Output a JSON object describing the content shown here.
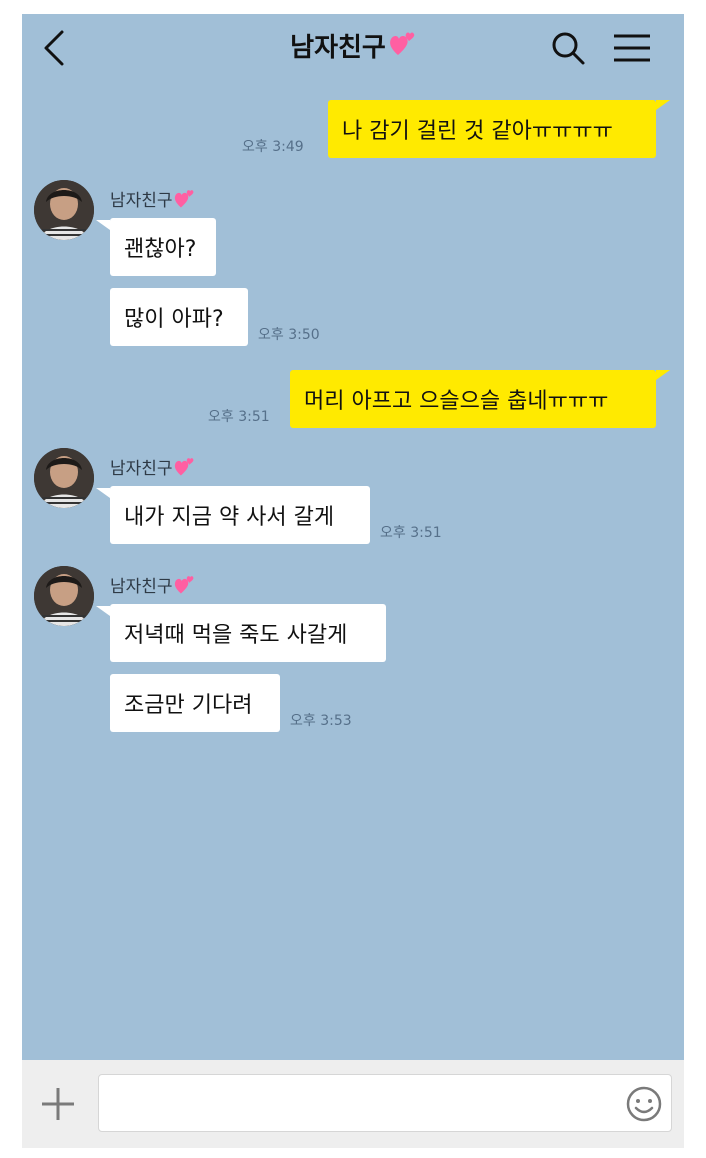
{
  "header": {
    "title": "남자친구",
    "back_icon": "chevron-left-icon",
    "search_icon": "search-icon",
    "menu_icon": "hamburger-menu-icon",
    "heart_icon": "pink-hearts-emoji"
  },
  "messages": [
    {
      "from": "me",
      "text": "나 감기 걸린 것 같아ㅠㅠㅠㅠ",
      "time": "오후 3:49"
    },
    {
      "from": "other",
      "sender": "남자친구",
      "text": "괜찮아?"
    },
    {
      "from": "other",
      "text": "많이 아파?",
      "time": "오후 3:50"
    },
    {
      "from": "me",
      "text": "머리 아프고 으슬으슬 춥네ㅠㅠㅠ",
      "time": "오후 3:51"
    },
    {
      "from": "other",
      "sender": "남자친구",
      "text": "내가 지금 약 사서 갈게",
      "time": "오후 3:51"
    },
    {
      "from": "other",
      "sender": "남자친구",
      "text": "저녁때 먹을 죽도 사갈게"
    },
    {
      "from": "other",
      "text": "조금만 기다려",
      "time": "오후 3:53"
    }
  ],
  "composer": {
    "input_value": "",
    "plus_icon": "plus-icon",
    "emoji_icon": "smiley-icon",
    "hash_label": "#"
  },
  "colors": {
    "chat_background": "#a1bfd7",
    "my_bubble": "#ffea00",
    "their_bubble": "#ffffff",
    "heart": "#ff5fa2"
  }
}
